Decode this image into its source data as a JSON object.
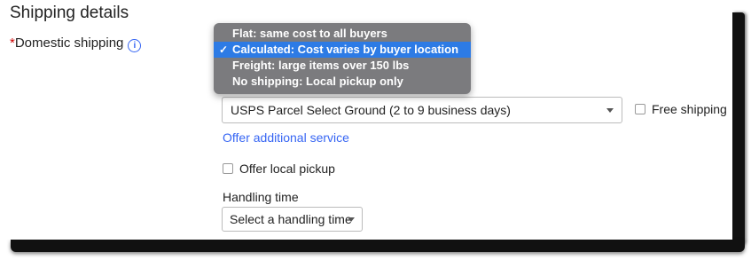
{
  "section": {
    "title": "Shipping details"
  },
  "domestic": {
    "required_mark": "*",
    "label": "Domestic shipping",
    "info_icon": "info-icon",
    "menu_options": [
      {
        "label": "Flat: same cost to all buyers",
        "selected": false
      },
      {
        "label": "Calculated: Cost varies by buyer location",
        "selected": true,
        "check": "✓"
      },
      {
        "label": "Freight: large items over 150 lbs",
        "selected": false
      },
      {
        "label": "No shipping: Local pickup only",
        "selected": false
      }
    ]
  },
  "service": {
    "selected": "USPS Parcel Select Ground (2 to 9 business days)",
    "free_shipping_label": "Free shipping",
    "free_shipping_checked": false
  },
  "offer_additional_service": "Offer additional service",
  "local_pickup": {
    "label": "Offer local pickup",
    "checked": false
  },
  "handling": {
    "label": "Handling time",
    "placeholder": "Select a handling time"
  },
  "colors": {
    "link": "#3665f3",
    "menu_bg": "#7b7b7e",
    "menu_selected": "#2d7be5",
    "required": "#cc0000"
  }
}
